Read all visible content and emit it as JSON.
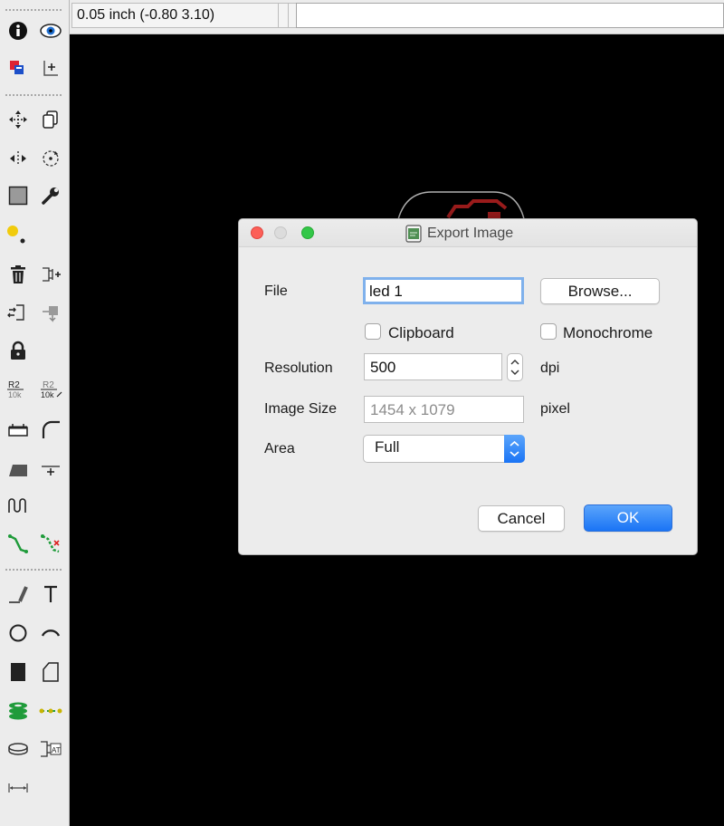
{
  "topbar": {
    "coordinate_readout": "0.05 inch (-0.80 3.10)",
    "command_line_value": ""
  },
  "toolbar": {
    "tools": [
      "info-icon",
      "show-eye-icon",
      "display-layers-icon",
      "mark-origin-icon",
      "move-icon",
      "copy-icon",
      "mirror-icon",
      "rotate-icon",
      "group-icon",
      "change-wrench-icon",
      "paste-icon",
      "delete-trash-icon",
      "add-part-icon",
      "pinswap-icon",
      "replace-icon",
      "lock-icon",
      "name-r2-icon",
      "value-r2-icon",
      "split-icon",
      "miter-icon",
      "optimize-icon",
      "meander-icon",
      "route-icon",
      "ripup-icon",
      "wire-icon",
      "text-icon",
      "circle-icon",
      "arc-icon",
      "rectangle-icon",
      "polygon-icon",
      "via-icon",
      "signal-icon",
      "hole-icon",
      "attribute-icon",
      "dimension-icon"
    ],
    "labels": {
      "name": "R2",
      "name_value": "10k"
    }
  },
  "dialog": {
    "title": "Export Image",
    "file_label": "File",
    "file_value": "led 1",
    "browse_label": "Browse...",
    "clipboard_label": "Clipboard",
    "clipboard_checked": false,
    "monochrome_label": "Monochrome",
    "monochrome_checked": false,
    "resolution_label": "Resolution",
    "resolution_value": "500",
    "resolution_unit": "dpi",
    "image_size_label": "Image Size",
    "image_size_value": "1454 x 1079",
    "image_size_unit": "pixel",
    "area_label": "Area",
    "area_value": "Full",
    "cancel_label": "Cancel",
    "ok_label": "OK"
  },
  "colors": {
    "canvas_bg": "#000000",
    "board_outline": "#b0b0b0",
    "copper_trace": "#9b1c1c",
    "ok_button": "#1a74f5",
    "toolbar_bg": "#ececec"
  }
}
